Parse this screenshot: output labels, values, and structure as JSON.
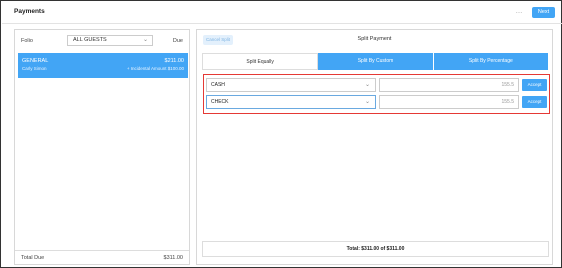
{
  "header": {
    "title": "Payments",
    "more_icon": "ellipsis-icon",
    "next_label": "Next"
  },
  "folio_panel": {
    "folio_label": "Folio",
    "guest_filter": "ALL GUESTS",
    "due_label": "Due",
    "rows": [
      {
        "name": "GENERAL",
        "guest": "Carly Simon",
        "amount": "$211.00",
        "incidental": "+ Incidental Amount $100.00"
      }
    ],
    "total_due_label": "Total Due",
    "total_due_value": "$311.00"
  },
  "split_panel": {
    "cancel_label": "Cancel Split",
    "title": "Split Payment",
    "tabs": [
      {
        "label": "Split Equally",
        "active": true
      },
      {
        "label": "Split By Custom",
        "active": false
      },
      {
        "label": "Split By Percentage",
        "active": false
      }
    ],
    "payments": [
      {
        "method": "CASH",
        "amount": "155.5",
        "accept_label": "Accept"
      },
      {
        "method": "CHECK",
        "amount": "155.5",
        "accept_label": "Accept"
      }
    ],
    "total_text": "Total: $311.00 of $311.00"
  },
  "colors": {
    "accent": "#42a5f5",
    "highlight_border": "#e53935"
  }
}
